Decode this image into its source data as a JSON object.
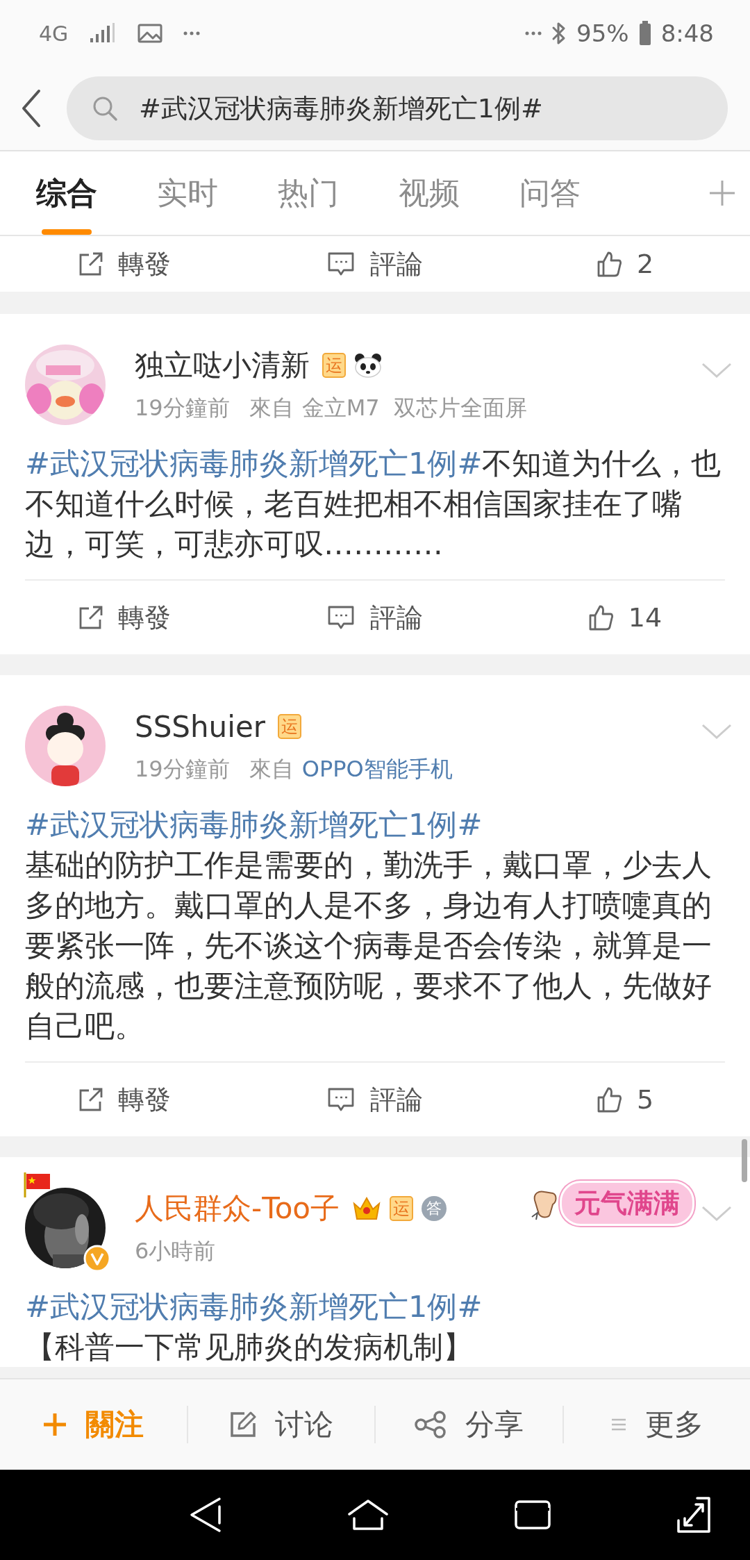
{
  "status_bar": {
    "network": "4G",
    "battery": "95%",
    "time": "8:48"
  },
  "search": {
    "value": "#武汉冠状病毒肺炎新增死亡1例#"
  },
  "tabs": [
    {
      "label": "综合",
      "selected": true
    },
    {
      "label": "实时",
      "selected": false
    },
    {
      "label": "热门",
      "selected": false
    },
    {
      "label": "视频",
      "selected": false
    },
    {
      "label": "问答",
      "selected": false
    }
  ],
  "partial_actions": {
    "repost": "轉發",
    "comment": "評論",
    "likes": "2"
  },
  "posts": [
    {
      "name": "独立哒小清新",
      "vip": false,
      "verified": false,
      "avatar_flag": false,
      "badges": [
        {
          "kind": "yun",
          "text": "运"
        },
        {
          "kind": "panda"
        }
      ],
      "time": "19分鐘前",
      "source_prefix": "來自",
      "source": "金立M7  双芯片全面屏",
      "source_link": false,
      "hashtag": "#武汉冠状病毒肺炎新增死亡1例#",
      "hashtag_own_line": false,
      "text": "不知道为什么，也不知道什么时候，老百姓把相不相信国家挂在了嘴边，可笑，可悲亦可叹…………",
      "actions": {
        "repost": "轉發",
        "comment": "評論",
        "likes": "14"
      }
    },
    {
      "name": "SSShuier",
      "vip": false,
      "verified": false,
      "avatar_flag": false,
      "badges": [
        {
          "kind": "yun",
          "text": "运"
        }
      ],
      "time": "19分鐘前",
      "source_prefix": "來自",
      "source": "OPPO智能手机",
      "source_link": true,
      "hashtag": "#武汉冠状病毒肺炎新增死亡1例#",
      "hashtag_own_line": true,
      "text": "基础的防护工作是需要的，勤洗手，戴口罩，少去人多的地方。戴口罩的人是不多，身边有人打喷嚏真的要紧张一阵，先不谈这个病毒是否会传染，就算是一般的流感，也要注意预防呢，要求不了他人，先做好自己吧。",
      "actions": {
        "repost": "轉發",
        "comment": "評論",
        "likes": "5"
      }
    },
    {
      "name": "人民群众-Too子",
      "vip": true,
      "verified": true,
      "avatar_flag": true,
      "badges": [
        {
          "kind": "crown"
        },
        {
          "kind": "yun",
          "text": "运"
        },
        {
          "kind": "medal",
          "text": "答"
        }
      ],
      "sticker": "元气满满",
      "time": "6小時前",
      "hashtag": "#武汉冠状病毒肺炎新增死亡1例#",
      "hashtag_own_line": true,
      "text": "【科普一下常见肺炎的发病机制】"
    }
  ],
  "bottom_bar": [
    {
      "kind": "follow",
      "label": "關注"
    },
    {
      "kind": "discuss",
      "label": "讨论"
    },
    {
      "kind": "share",
      "label": "分享"
    },
    {
      "kind": "more",
      "label": "更多"
    }
  ]
}
